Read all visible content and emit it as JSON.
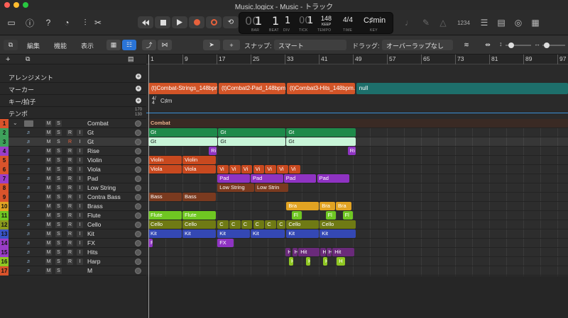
{
  "window": {
    "title": "Music.logicx - Music - トラック",
    "traffic_lights": [
      "#fe5f57",
      "#febc2e",
      "#28c840"
    ]
  },
  "control_bar": {
    "lcd": {
      "bar": "1",
      "beat": "1",
      "div": "1",
      "tick": "1",
      "tempo": "148",
      "tempo_mode": "KEEP",
      "time_sig": "4/4",
      "key": "C♯min",
      "labels": {
        "bar": "BAR",
        "beat": "BEAT",
        "div": "DIV",
        "tick": "TICK",
        "tempo": "TEMPO",
        "time": "TIME",
        "key": "KEY"
      }
    },
    "count_label": "1234",
    "record_color": "#e7613c"
  },
  "toolbar": {
    "menus": [
      "編集",
      "機能",
      "表示"
    ],
    "snap_label": "スナップ:",
    "snap_value": "スマート",
    "drag_label": "ドラッグ:",
    "drag_value": "オーバーラップなし"
  },
  "global_tracks": {
    "arrangement": "アレンジメント",
    "marker": "マーカー",
    "signature": "キー/拍子",
    "tempo": "テンポ",
    "tempo_range_top": "170",
    "tempo_range_bottom": "130",
    "signature_values": {
      "time": "4/4",
      "key": "C♯m"
    }
  },
  "ruler": {
    "labels": [
      "1",
      "9",
      "17",
      "25",
      "33",
      "41",
      "49",
      "57",
      "65",
      "73",
      "81",
      "89",
      "97"
    ]
  },
  "markers": [
    {
      "label": "(t)Combat-Strings_148bpm...",
      "color": "#d25427"
    },
    {
      "label": "(t)Combat2-Pad_148bpm...",
      "color": "#d25427"
    },
    {
      "label": "(t)Combat3-Hits_148bpm...",
      "color": "#d25427"
    },
    {
      "label": "null",
      "color": "#1d6f6b"
    }
  ],
  "tracks": [
    {
      "num": "1",
      "name": "Combat",
      "color": "#d9532b",
      "folder": true
    },
    {
      "num": "2",
      "name": "Gt",
      "color": "#3ea15b"
    },
    {
      "num": "3",
      "name": "Gt",
      "color": "#3ea15b",
      "selected": true
    },
    {
      "num": "4",
      "name": "Rise",
      "color": "#9a3dc8"
    },
    {
      "num": "5",
      "name": "Violin",
      "color": "#d9532b"
    },
    {
      "num": "6",
      "name": "Viola",
      "color": "#d9532b"
    },
    {
      "num": "7",
      "name": "Pad",
      "color": "#9a3dc8"
    },
    {
      "num": "8",
      "name": "Low String",
      "color": "#d9532b"
    },
    {
      "num": "9",
      "name": "Contra Bass",
      "color": "#d9532b"
    },
    {
      "num": "10",
      "name": "Brass",
      "color": "#e2a322"
    },
    {
      "num": "11",
      "name": "Flute",
      "color": "#6fc722"
    },
    {
      "num": "12",
      "name": "Cello",
      "color": "#8a9a1e"
    },
    {
      "num": "13",
      "name": "Kit",
      "color": "#3a55c8"
    },
    {
      "num": "14",
      "name": "FX",
      "color": "#9a3dc8"
    },
    {
      "num": "15",
      "name": "Hits",
      "color": "#9a3dc8"
    },
    {
      "num": "16",
      "name": "Harp",
      "color": "#8fc722"
    },
    {
      "num": "17",
      "name": "M",
      "color": "#d9532b"
    }
  ],
  "track_buttons": {
    "mute": "M",
    "solo": "S",
    "record": "R",
    "input": "I"
  },
  "regions": {
    "folder": "Combat",
    "gt": "Gt",
    "violin": "Violin",
    "violin_short": "Vi",
    "viola": "Viola",
    "pad": "Pad",
    "low_string": "Low String",
    "low_strin": "Low Strin",
    "bass": "Bass",
    "brass": "Bra",
    "flute": "Flute",
    "flute_short": "Fl",
    "cello": "Cello",
    "cello_short": "C",
    "kit": "Kit",
    "fx": "FX",
    "hit": "Hit",
    "h": "H",
    "rise": "Ri"
  }
}
